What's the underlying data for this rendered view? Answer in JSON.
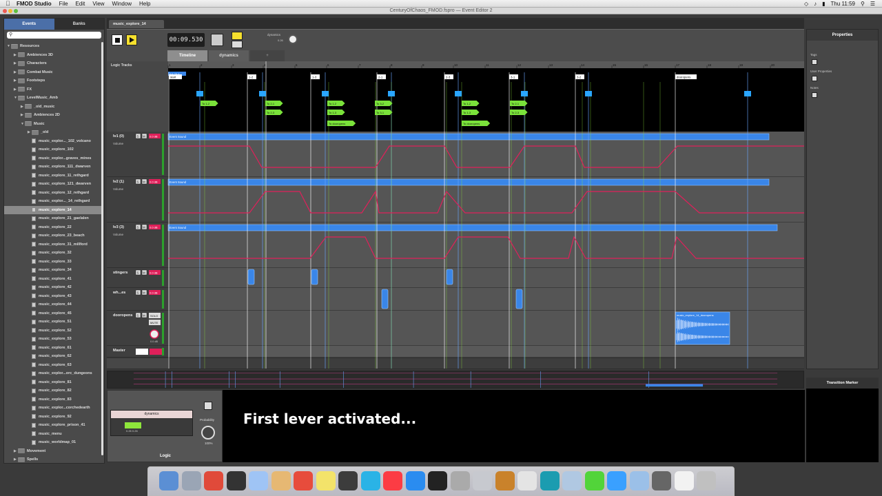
{
  "menubar": {
    "items": [
      "FMOD Studio",
      "File",
      "Edit",
      "View",
      "Window",
      "Help"
    ],
    "clock": "Thu 11:59"
  },
  "window": {
    "title": "CenturyOfChaos_FMOD.fspro — Event Editor 2"
  },
  "browser": {
    "tabs": [
      "Events",
      "Banks"
    ],
    "tree": [
      {
        "label": "Resources",
        "depth": 0,
        "kind": "folder",
        "open": true
      },
      {
        "label": "Ambiences 3D",
        "depth": 1,
        "kind": "folder"
      },
      {
        "label": "Characters",
        "depth": 1,
        "kind": "folder"
      },
      {
        "label": "Combat Music",
        "depth": 1,
        "kind": "folder"
      },
      {
        "label": "Footsteps",
        "depth": 1,
        "kind": "folder"
      },
      {
        "label": "FX",
        "depth": 1,
        "kind": "folder"
      },
      {
        "label": "LevelMusic_Amb",
        "depth": 1,
        "kind": "folder",
        "open": true
      },
      {
        "label": "_old_music",
        "depth": 2,
        "kind": "folder"
      },
      {
        "label": "Ambiences 2D",
        "depth": 2,
        "kind": "folder"
      },
      {
        "label": "Music",
        "depth": 2,
        "kind": "folder",
        "open": true
      },
      {
        "label": "_old",
        "depth": 3,
        "kind": "folder"
      },
      {
        "label": "music_explor..._102_volcano",
        "depth": 3,
        "kind": "event"
      },
      {
        "label": "music_explore_102",
        "depth": 3,
        "kind": "event"
      },
      {
        "label": "music_explor...graves_mines",
        "depth": 3,
        "kind": "event"
      },
      {
        "label": "music_explore_111_dwarven",
        "depth": 3,
        "kind": "event"
      },
      {
        "label": "music_explore_11_rethgard",
        "depth": 3,
        "kind": "event"
      },
      {
        "label": "music_explore_121_dwarven",
        "depth": 3,
        "kind": "event"
      },
      {
        "label": "music_explore_12_rethgard",
        "depth": 3,
        "kind": "event"
      },
      {
        "label": "music_explor..._14_rethgard",
        "depth": 3,
        "kind": "event"
      },
      {
        "label": "music_explore_14",
        "depth": 3,
        "kind": "event",
        "selected": true
      },
      {
        "label": "music_explore_21_gaelalen",
        "depth": 3,
        "kind": "event"
      },
      {
        "label": "music_explore_22",
        "depth": 3,
        "kind": "event"
      },
      {
        "label": "music_explore_23_beach",
        "depth": 3,
        "kind": "event"
      },
      {
        "label": "music_explore_31_millford",
        "depth": 3,
        "kind": "event"
      },
      {
        "label": "music_explore_32",
        "depth": 3,
        "kind": "event"
      },
      {
        "label": "music_explore_33",
        "depth": 3,
        "kind": "event"
      },
      {
        "label": "music_explore_34",
        "depth": 3,
        "kind": "event"
      },
      {
        "label": "music_explore_41",
        "depth": 3,
        "kind": "event"
      },
      {
        "label": "music_explore_42",
        "depth": 3,
        "kind": "event"
      },
      {
        "label": "music_explore_43",
        "depth": 3,
        "kind": "event"
      },
      {
        "label": "music_explore_44",
        "depth": 3,
        "kind": "event"
      },
      {
        "label": "music_explore_45",
        "depth": 3,
        "kind": "event"
      },
      {
        "label": "music_explore_51",
        "depth": 3,
        "kind": "event"
      },
      {
        "label": "music_explore_52",
        "depth": 3,
        "kind": "event"
      },
      {
        "label": "music_explore_53",
        "depth": 3,
        "kind": "event"
      },
      {
        "label": "music_explore_61",
        "depth": 3,
        "kind": "event"
      },
      {
        "label": "music_explore_62",
        "depth": 3,
        "kind": "event"
      },
      {
        "label": "music_explore_63",
        "depth": 3,
        "kind": "event"
      },
      {
        "label": "music_explor...orc_dungeons",
        "depth": 3,
        "kind": "event"
      },
      {
        "label": "music_explore_81",
        "depth": 3,
        "kind": "event"
      },
      {
        "label": "music_explore_82",
        "depth": 3,
        "kind": "event"
      },
      {
        "label": "music_explore_83",
        "depth": 3,
        "kind": "event"
      },
      {
        "label": "music_explor...corchedearth",
        "depth": 3,
        "kind": "event"
      },
      {
        "label": "music_explore_92",
        "depth": 3,
        "kind": "event"
      },
      {
        "label": "music_explore_prison_41",
        "depth": 3,
        "kind": "event"
      },
      {
        "label": "music_menu",
        "depth": 3,
        "kind": "event"
      },
      {
        "label": "music_worldmap_01",
        "depth": 3,
        "kind": "event"
      },
      {
        "label": "Movement",
        "depth": 1,
        "kind": "folder"
      },
      {
        "label": "Spells",
        "depth": 1,
        "kind": "folder"
      }
    ]
  },
  "editor": {
    "event_tab": "music_explore_14",
    "time": "00:09.530",
    "dynamics_label": "dynamics",
    "dynamics_value": "0.26",
    "subtabs": [
      "Timeline",
      "dynamics",
      "+"
    ],
    "logic_tracks_label": "Logic Tracks",
    "ruler": [
      "1",
      "2",
      "3",
      "4",
      "5",
      "6",
      "7",
      "8",
      "9",
      "10",
      "11",
      "12",
      "13",
      "14",
      "15",
      "16",
      "17",
      "18",
      "19",
      "20"
    ],
    "tempo_marker": "4/4 76.6",
    "destination_markers": [
      "start",
      "1-2",
      "1-3",
      "2-1",
      "2-3",
      "3-1",
      "3-2",
      "dooropens"
    ],
    "transition_labels": [
      "To 1-2",
      "To 2-1",
      "To 2-3",
      "To 1-2",
      "To 1-3",
      "To 3-2",
      "To 3-1",
      "To 1-2",
      "To 1-3",
      "To 2-1",
      "To 2-3",
      "To dooropens",
      "To dooropens"
    ],
    "tracks": [
      {
        "name": "lv1 (0)",
        "clip": "Event Sound",
        "auto": "Volume"
      },
      {
        "name": "lv2 (1)",
        "clip": "Event Sound",
        "auto": "Volume"
      },
      {
        "name": "lv3 (3)",
        "clip": "Event Sound",
        "auto": "Volume"
      },
      {
        "name": "stingers"
      },
      {
        "name": "wh...es"
      },
      {
        "name": "dooropens",
        "clip": "music_explore_14_dooropens",
        "solo": "SOLO",
        "mute": "MUTE",
        "vol": "0.0 dB"
      },
      {
        "name": "Master"
      }
    ],
    "track_buttons": {
      "s": "S",
      "m": "M",
      "vol": "0.0 dB"
    }
  },
  "parameter_panel": {
    "param_name": "dynamics",
    "range_a": "0.26",
    "range_b": "0.26",
    "probability_label": "Probability",
    "probability_value": "100%",
    "footer": "Logic"
  },
  "caption": "First lever activated...",
  "properties": {
    "title": "Properties",
    "labels": [
      "Tags",
      "User Properties",
      "Notes"
    ],
    "transition_marker": "Transition Marker"
  },
  "colors": {
    "clip_blue": "#3a86e8",
    "automation_pink": "#e0205a",
    "transition_green": "#7ae23a",
    "play_yellow": "#f6e02e",
    "selection_blue": "#4b6fa8"
  }
}
